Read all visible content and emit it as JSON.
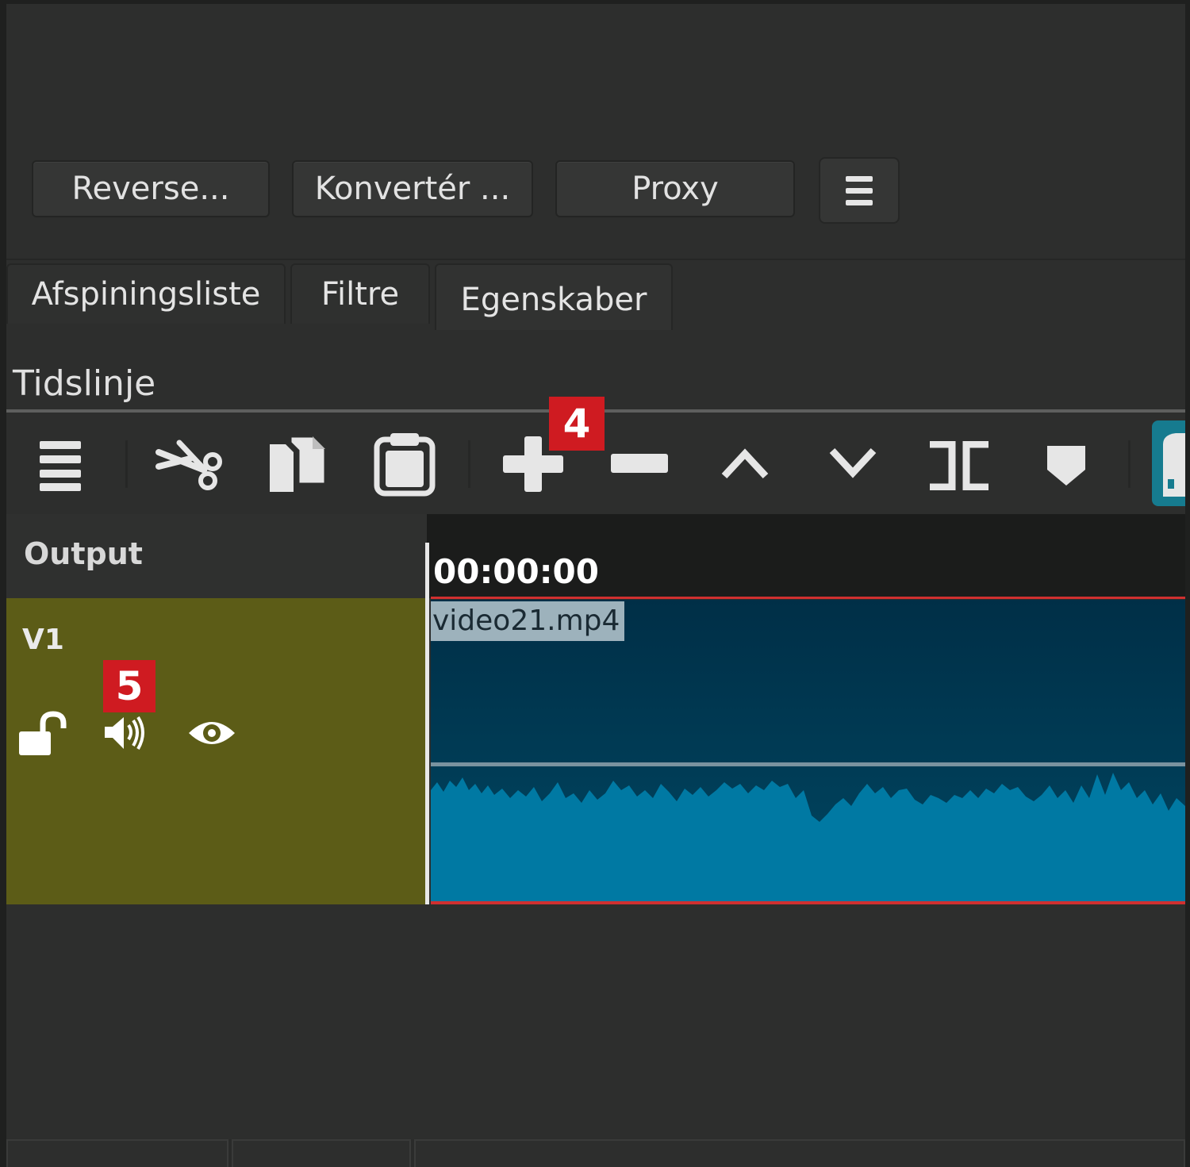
{
  "panel_buttons": {
    "reverse": "Reverse...",
    "convert": "Konvertér ...",
    "proxy": "Proxy"
  },
  "tabs": [
    {
      "label": "Afspiningsliste"
    },
    {
      "label": "Filtre"
    },
    {
      "label": "Egenskaber",
      "selected": true
    }
  ],
  "timeline": {
    "title": "Tidslinje",
    "toolbar_icons": [
      "menu-icon",
      "cut-icon",
      "copy-icon",
      "paste-icon",
      "append-icon",
      "remove-icon",
      "lift-icon",
      "overwrite-icon",
      "split-icon",
      "marker-icon",
      "snap-icon"
    ],
    "badges": {
      "append": "4",
      "mute": "5"
    },
    "output_label": "Output",
    "timecode": "00:00:00",
    "track": {
      "name": "V1",
      "icons": [
        "unlock-icon",
        "speaker-icon",
        "eye-icon"
      ]
    },
    "clip": {
      "name": "video21.mp4"
    }
  },
  "colors": {
    "background": "#2d2e2d",
    "track_header": "#5c5c17",
    "clip_video": "#003a54",
    "clip_audio": "#0079a3",
    "badge": "#cf1b21",
    "trim_line": "#d03030"
  }
}
